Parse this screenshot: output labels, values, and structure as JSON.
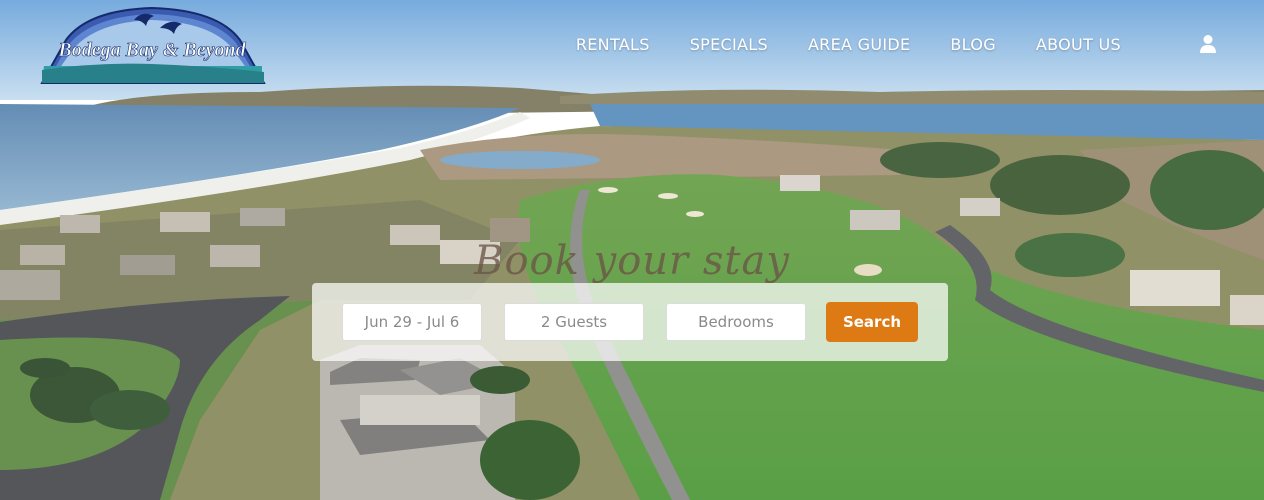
{
  "brand": {
    "name": "Bodega Bay & Beyond",
    "colors": {
      "logo_blue": "#3a5bb0",
      "logo_dark": "#142a6b",
      "accent": "#de7a14"
    }
  },
  "nav": {
    "items": [
      {
        "label": "RENTALS"
      },
      {
        "label": "SPECIALS"
      },
      {
        "label": "AREA GUIDE"
      },
      {
        "label": "BLOG"
      },
      {
        "label": "ABOUT US"
      }
    ],
    "account_icon": "user-icon"
  },
  "hero": {
    "heading": "Book your stay"
  },
  "search": {
    "dates": "Jun 29 - Jul 6",
    "guests": "2 Guests",
    "bedrooms_placeholder": "Bedrooms",
    "button_label": "Search"
  }
}
